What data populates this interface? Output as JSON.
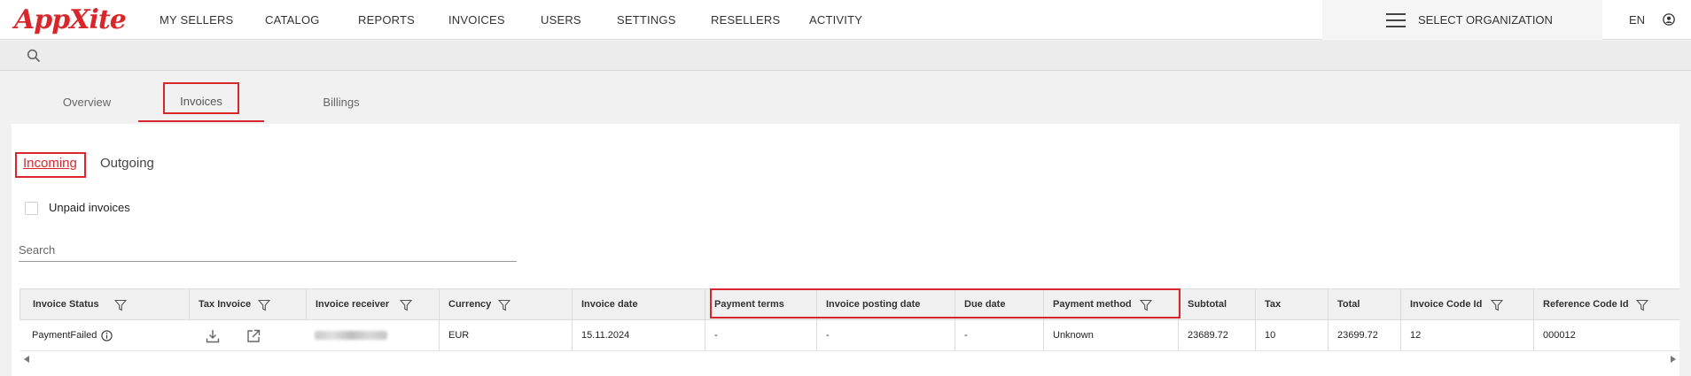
{
  "app": {
    "logo_text": "AppXite"
  },
  "nav": {
    "items": [
      "MY SELLERS",
      "CATALOG",
      "REPORTS",
      "INVOICES",
      "USERS",
      "SETTINGS",
      "RESELLERS",
      "ACTIVITY"
    ],
    "org_label": "SELECT ORGANIZATION",
    "lang": "EN"
  },
  "tabs": {
    "overview": "Overview",
    "invoices": "Invoices",
    "billings": "Billings"
  },
  "subtabs": {
    "incoming": "Incoming",
    "outgoing": "Outgoing"
  },
  "filters": {
    "unpaid_label": "Unpaid invoices",
    "search_placeholder": "Search"
  },
  "table": {
    "columns": [
      "Invoice Status",
      "Tax Invoice",
      "Invoice receiver",
      "Currency",
      "Invoice date",
      "Payment terms",
      "Invoice posting date",
      "Due date",
      "Payment method",
      "Subtotal",
      "Tax",
      "Total",
      "Invoice Code Id",
      "Reference Code Id"
    ],
    "row": {
      "status": "PaymentFailed",
      "currency": "EUR",
      "invoice_date": "15.11.2024",
      "payment_terms": "-",
      "posting_date": "-",
      "due_date": "-",
      "payment_method": "Unknown",
      "subtotal": "23689.72",
      "tax": "10",
      "total": "23699.72",
      "invoice_code": "12",
      "reference_code": "000012"
    }
  },
  "colors": {
    "accent": "#d9262b"
  }
}
